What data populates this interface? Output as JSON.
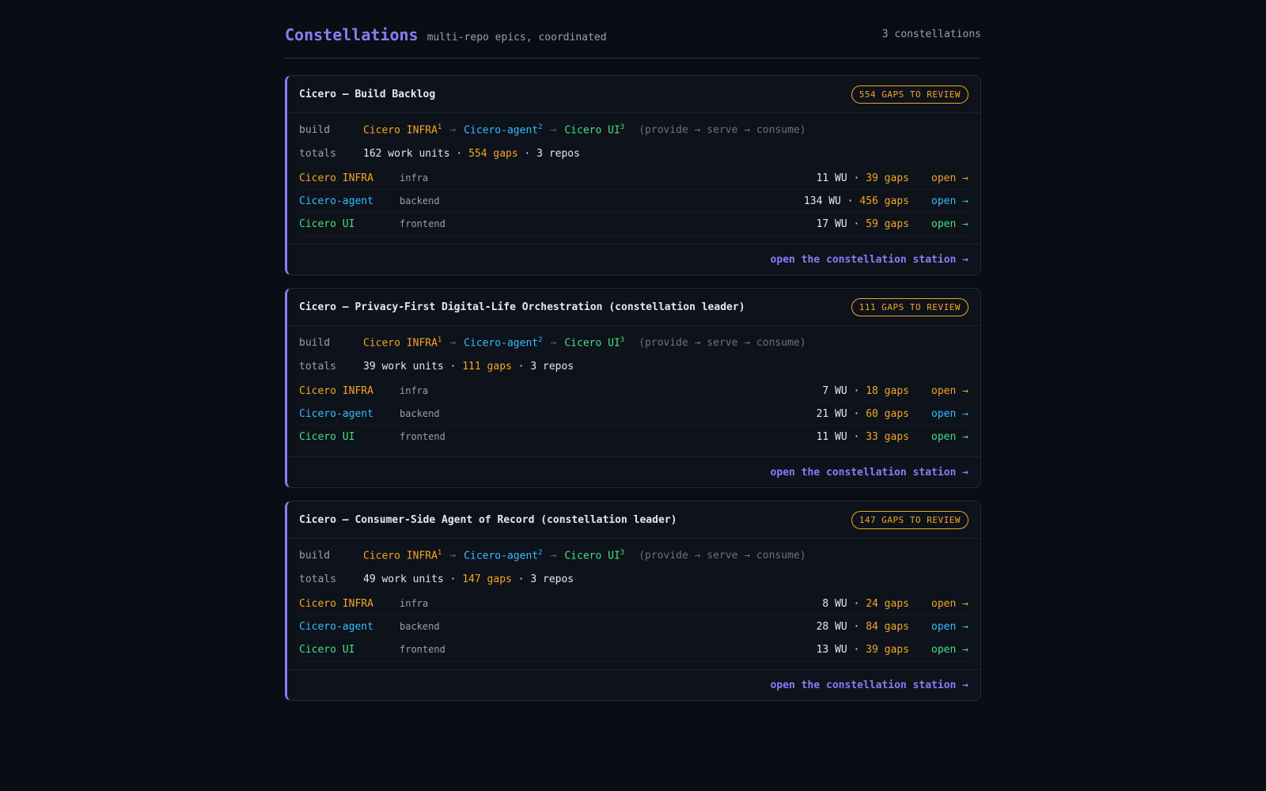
{
  "header": {
    "title": "Constellations",
    "subtitle": "multi-repo epics, coordinated",
    "count": "3 constellations"
  },
  "labels": {
    "build": "build",
    "totals": "totals",
    "arrow": "→",
    "note": "(provide → serve → consume)",
    "open": "open →",
    "station": "open the constellation station →",
    "sep": "·"
  },
  "colors": {
    "accent": "#8b7cf6",
    "infra": "#f5a524",
    "agent": "#38bdf8",
    "ui": "#4ade80",
    "gaps": "#f5a524"
  },
  "constellations": [
    {
      "title": "Cicero — Build Backlog",
      "badge": "554 GAPS TO REVIEW",
      "build": [
        {
          "name": "Cicero INFRA",
          "sup": "1"
        },
        {
          "name": "Cicero-agent",
          "sup": "2"
        },
        {
          "name": "Cicero UI",
          "sup": "3"
        }
      ],
      "totals": {
        "units": "162 work units",
        "gaps": "554 gaps",
        "repos": "3 repos"
      },
      "repos": [
        {
          "name": "Cicero INFRA",
          "role": "infra",
          "wu": "11 WU",
          "gaps": "39 gaps"
        },
        {
          "name": "Cicero-agent",
          "role": "backend",
          "wu": "134 WU",
          "gaps": "456 gaps"
        },
        {
          "name": "Cicero UI",
          "role": "frontend",
          "wu": "17 WU",
          "gaps": "59 gaps"
        }
      ]
    },
    {
      "title": "Cicero — Privacy-First Digital-Life Orchestration (constellation leader)",
      "badge": "111 GAPS TO REVIEW",
      "build": [
        {
          "name": "Cicero INFRA",
          "sup": "1"
        },
        {
          "name": "Cicero-agent",
          "sup": "2"
        },
        {
          "name": "Cicero UI",
          "sup": "3"
        }
      ],
      "totals": {
        "units": "39 work units",
        "gaps": "111 gaps",
        "repos": "3 repos"
      },
      "repos": [
        {
          "name": "Cicero INFRA",
          "role": "infra",
          "wu": "7 WU",
          "gaps": "18 gaps"
        },
        {
          "name": "Cicero-agent",
          "role": "backend",
          "wu": "21 WU",
          "gaps": "60 gaps"
        },
        {
          "name": "Cicero UI",
          "role": "frontend",
          "wu": "11 WU",
          "gaps": "33 gaps"
        }
      ]
    },
    {
      "title": "Cicero — Consumer-Side Agent of Record (constellation leader)",
      "badge": "147 GAPS TO REVIEW",
      "build": [
        {
          "name": "Cicero INFRA",
          "sup": "1"
        },
        {
          "name": "Cicero-agent",
          "sup": "2"
        },
        {
          "name": "Cicero UI",
          "sup": "3"
        }
      ],
      "totals": {
        "units": "49 work units",
        "gaps": "147 gaps",
        "repos": "3 repos"
      },
      "repos": [
        {
          "name": "Cicero INFRA",
          "role": "infra",
          "wu": "8 WU",
          "gaps": "24 gaps"
        },
        {
          "name": "Cicero-agent",
          "role": "backend",
          "wu": "28 WU",
          "gaps": "84 gaps"
        },
        {
          "name": "Cicero UI",
          "role": "frontend",
          "wu": "13 WU",
          "gaps": "39 gaps"
        }
      ]
    }
  ]
}
